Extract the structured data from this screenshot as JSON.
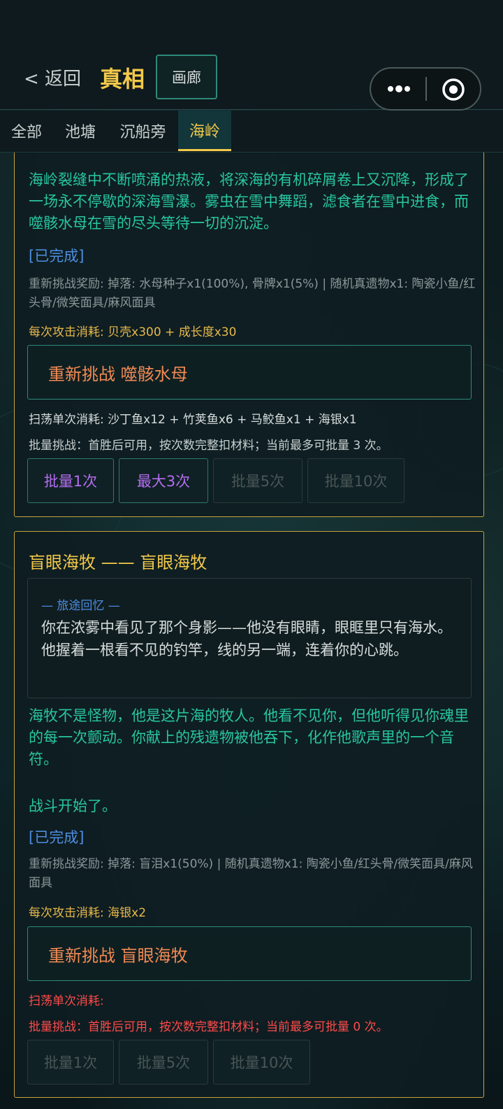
{
  "header": {
    "back_label": "< 返回",
    "title": "真相",
    "gallery_label": "画廊"
  },
  "tabs": [
    {
      "label": "全部",
      "active": false
    },
    {
      "label": "池塘",
      "active": false
    },
    {
      "label": "沉船旁",
      "active": false
    },
    {
      "label": "海岭",
      "active": true
    }
  ],
  "card1": {
    "description": "海岭裂缝中不断喷涌的热液，将深海的有机碎屑卷上又沉降，形成了一场永不停歇的深海雪瀑。雾虫在雪中舞蹈，滤食者在雪中进食，而噬骸水母在雪的尽头等待一切的沉淀。",
    "status": "[已完成]",
    "reward": "重新挑战奖励: 掉落: 水母种子x1(100%), 骨牌x1(5%) | 随机真遗物x1: 陶瓷小鱼/红头骨/微笑面具/麻风面具",
    "attack_cost": "每次攻击消耗: 贝壳x300 + 成长度x30",
    "challenge_label": "重新挑战 噬骸水母",
    "sweep_cost": "扫荡单次消耗: 沙丁鱼x12 + 竹荚鱼x6 + 马鲛鱼x1 + 海银x1",
    "batch_note": "批量挑战：首胜后可用，按次数完整扣材料；当前最多可批量 3 次。",
    "batch_buttons": [
      {
        "label": "批量1次",
        "enabled": true
      },
      {
        "label": "最大3次",
        "enabled": true
      },
      {
        "label": "批量5次",
        "enabled": false
      },
      {
        "label": "批量10次",
        "enabled": false
      }
    ]
  },
  "card2": {
    "title": "盲眼海牧 —— 盲眼海牧",
    "memory_label": "— 旅途回忆 —",
    "memory_text": "你在浓雾中看见了那个身影——他没有眼睛，眼眶里只有海水。他握着一根看不见的钓竿，线的另一端，连着你的心跳。",
    "description": "海牧不是怪物，他是这片海的牧人。他看不见你，但他听得见你魂里的每一次颤动。你献上的残遗物被他吞下，化作他歌声里的一个音符。",
    "description2": "战斗开始了。",
    "status": "[已完成]",
    "reward": "重新挑战奖励: 掉落: 盲泪x1(50%) | 随机真遗物x1: 陶瓷小鱼/红头骨/微笑面具/麻风面具",
    "attack_cost": "每次攻击消耗: 海银x2",
    "challenge_label": "重新挑战 盲眼海牧",
    "sweep_cost": "扫荡单次消耗:",
    "batch_note": "批量挑战：首胜后可用，按次数完整扣材料；当前最多可批量 0 次。",
    "batch_buttons": [
      {
        "label": "批量1次",
        "enabled": false
      },
      {
        "label": "批量5次",
        "enabled": false
      },
      {
        "label": "批量10次",
        "enabled": false
      }
    ]
  },
  "colors": {
    "accent_gold": "#f3c94a",
    "teal_text": "#28c6a0",
    "status_blue": "#4e8de0",
    "challenge_orange": "#f28a52",
    "batch_purple": "#b56cf0",
    "warning_red": "#ff4a4a"
  }
}
